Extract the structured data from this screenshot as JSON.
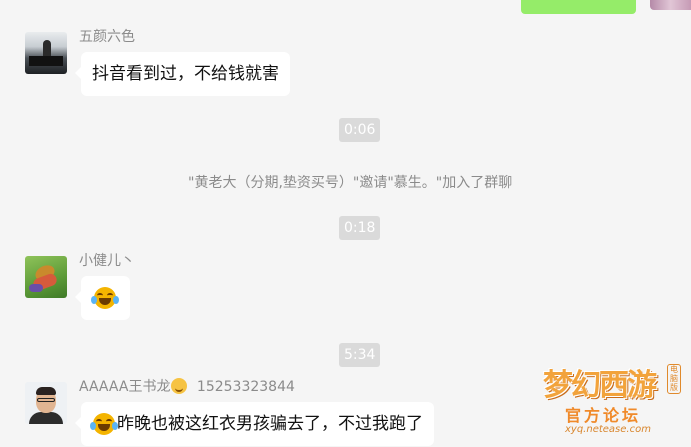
{
  "messages": [
    {
      "sender": "五颜六色",
      "text": "抖音看到过，不给钱就害"
    },
    {
      "time": "0:06"
    },
    {
      "system": "\"黄老大（分期,垫资买号）\"邀请\"慕生。\"加入了群聊"
    },
    {
      "time": "0:18"
    },
    {
      "sender": "小健儿丶",
      "text": ""
    },
    {
      "time": "5:34"
    },
    {
      "sender": "AAAAA王书龙",
      "phone": "15253323844",
      "text": "昨晚也被这红衣男孩骗去了，不过我跑了"
    }
  ],
  "watermark": {
    "title": "梦幻西游",
    "badge": "电脑版",
    "subtitle": "官方论坛",
    "url": "xyq.netease.com"
  }
}
